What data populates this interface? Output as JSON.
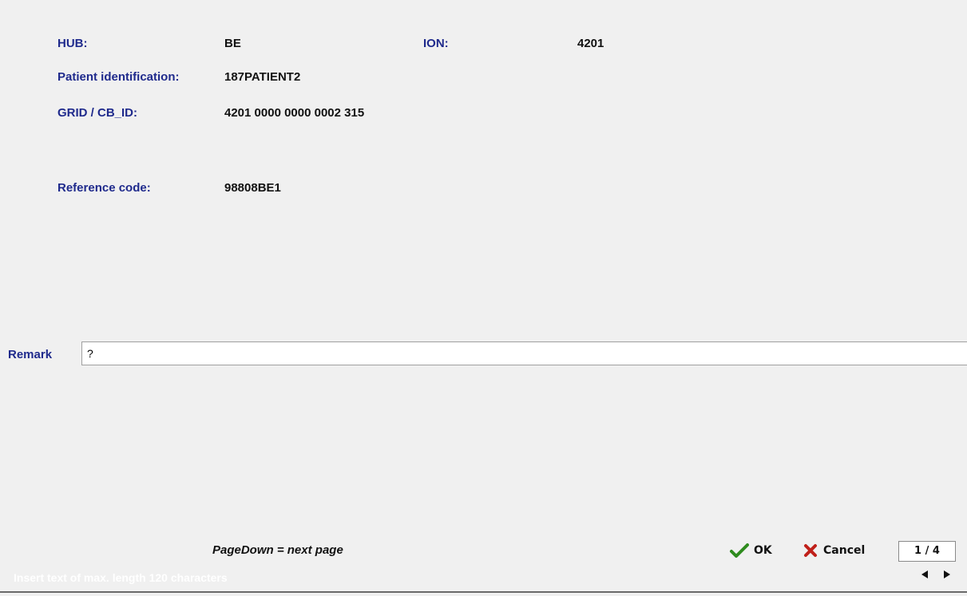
{
  "fields": {
    "hub": {
      "label": "HUB:",
      "value": "BE"
    },
    "ion": {
      "label": "ION:",
      "value": "4201"
    },
    "patient": {
      "label": "Patient identification:",
      "value": "187PATIENT2"
    },
    "grid": {
      "label": "GRID / CB_ID:",
      "value": "4201 0000 0000 0002 315"
    },
    "reference": {
      "label": "Reference code:",
      "value": "98808BE1"
    }
  },
  "remark": {
    "label": "Remark",
    "value": "?"
  },
  "footer": {
    "hint": "PageDown = next page",
    "ok_label": "OK",
    "cancel_label": "Cancel",
    "page_indicator": "1 / 4",
    "status_text": "Insert text of max. length 120 characters"
  },
  "colors": {
    "label": "#1f2a8c",
    "ok_check": "#2e8b1e",
    "cancel_x": "#c0201a"
  },
  "icons": [
    "check-icon",
    "cross-icon",
    "arrow-left-icon",
    "arrow-right-icon"
  ]
}
